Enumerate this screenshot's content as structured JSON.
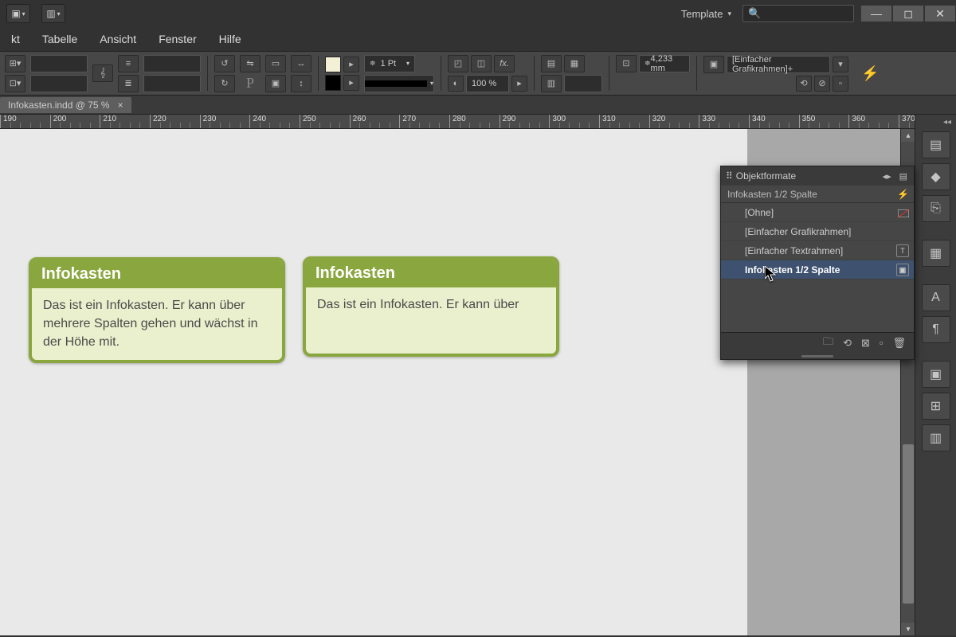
{
  "titlebar": {
    "workspace_label": "Template",
    "search_placeholder": ""
  },
  "menu": {
    "items": [
      "kt",
      "Tabelle",
      "Ansicht",
      "Fenster",
      "Hilfe"
    ]
  },
  "control": {
    "stroke_weight": "1 Pt",
    "zoom": "100 %",
    "measure": "4,233 mm",
    "style_dropdown": "[Einfacher Grafikrahmen]+"
  },
  "doc_tab": {
    "label": "Infokasten.indd @ 75 %"
  },
  "ruler": {
    "start": 190,
    "end": 370,
    "step": 10
  },
  "boxes": {
    "a": {
      "title": "Infokasten",
      "body": "Das ist ein Infokasten. Er kann über mehrere Spalten gehen und wächst in der Höhe mit."
    },
    "b": {
      "title": "Infokasten",
      "body": "Das ist ein Infokasten. Er kann über"
    }
  },
  "panel": {
    "title": "Objektformate",
    "current": "Infokasten 1/2 Spalte",
    "items": [
      {
        "label": "[Ohne]"
      },
      {
        "label": "[Einfacher Grafikrahmen]"
      },
      {
        "label": "[Einfacher Textrahmen]"
      },
      {
        "label": "Infokasten 1/2 Spalte"
      }
    ]
  },
  "colors": {
    "box_accent": "#8aa63e",
    "box_fill": "#eaf0cd"
  }
}
